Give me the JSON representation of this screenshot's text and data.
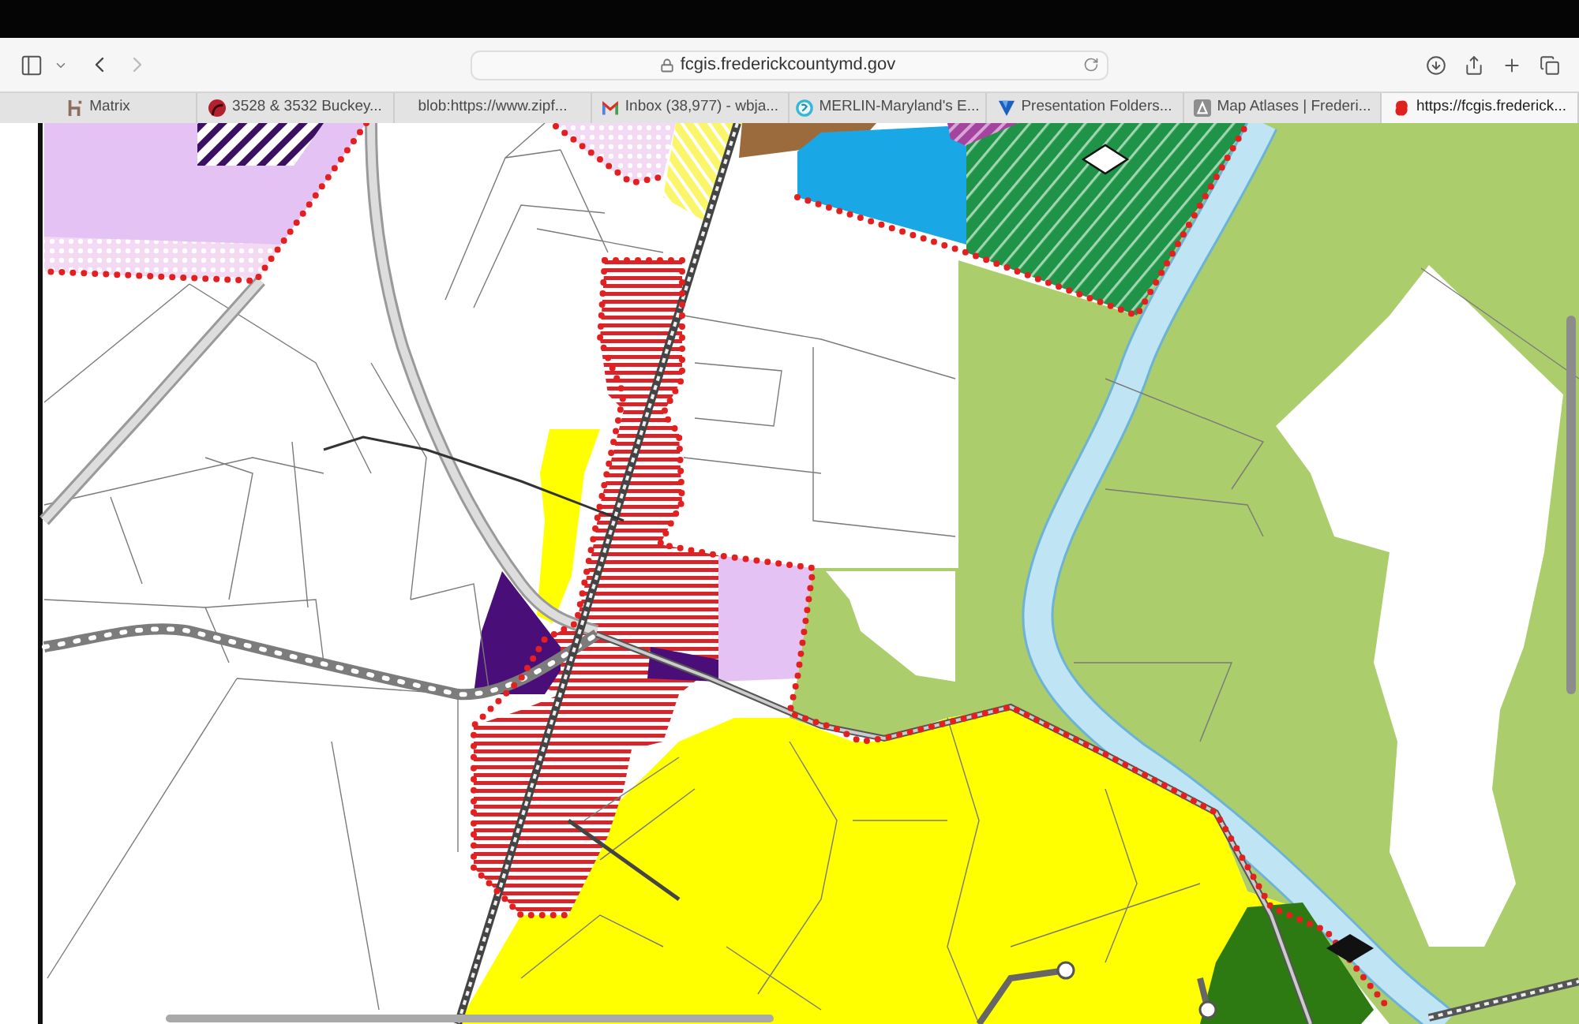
{
  "toolbar": {
    "back": {
      "enabled": true
    },
    "forward": {
      "enabled": false
    },
    "address": "fcgis.frederickcountymd.gov"
  },
  "tabs": [
    {
      "title": "Matrix",
      "kind": "h-logo",
      "selected": false
    },
    {
      "title": "3528 & 3532 Buckey...",
      "kind": "circle",
      "selected": false
    },
    {
      "title": "blob:https://www.zipf...",
      "kind": "none",
      "selected": false
    },
    {
      "title": "Inbox (38,977) - wbja...",
      "kind": "mail",
      "selected": false
    },
    {
      "title": "MERLIN-Maryland's E...",
      "kind": "ring",
      "selected": false
    },
    {
      "title": "Presentation Folders...",
      "kind": "v-mark",
      "selected": false
    },
    {
      "title": "Map Atlases | Frederi...",
      "kind": "square",
      "selected": false
    },
    {
      "title": "https://fcgis.frederick...",
      "kind": "blob",
      "selected": true
    }
  ]
}
